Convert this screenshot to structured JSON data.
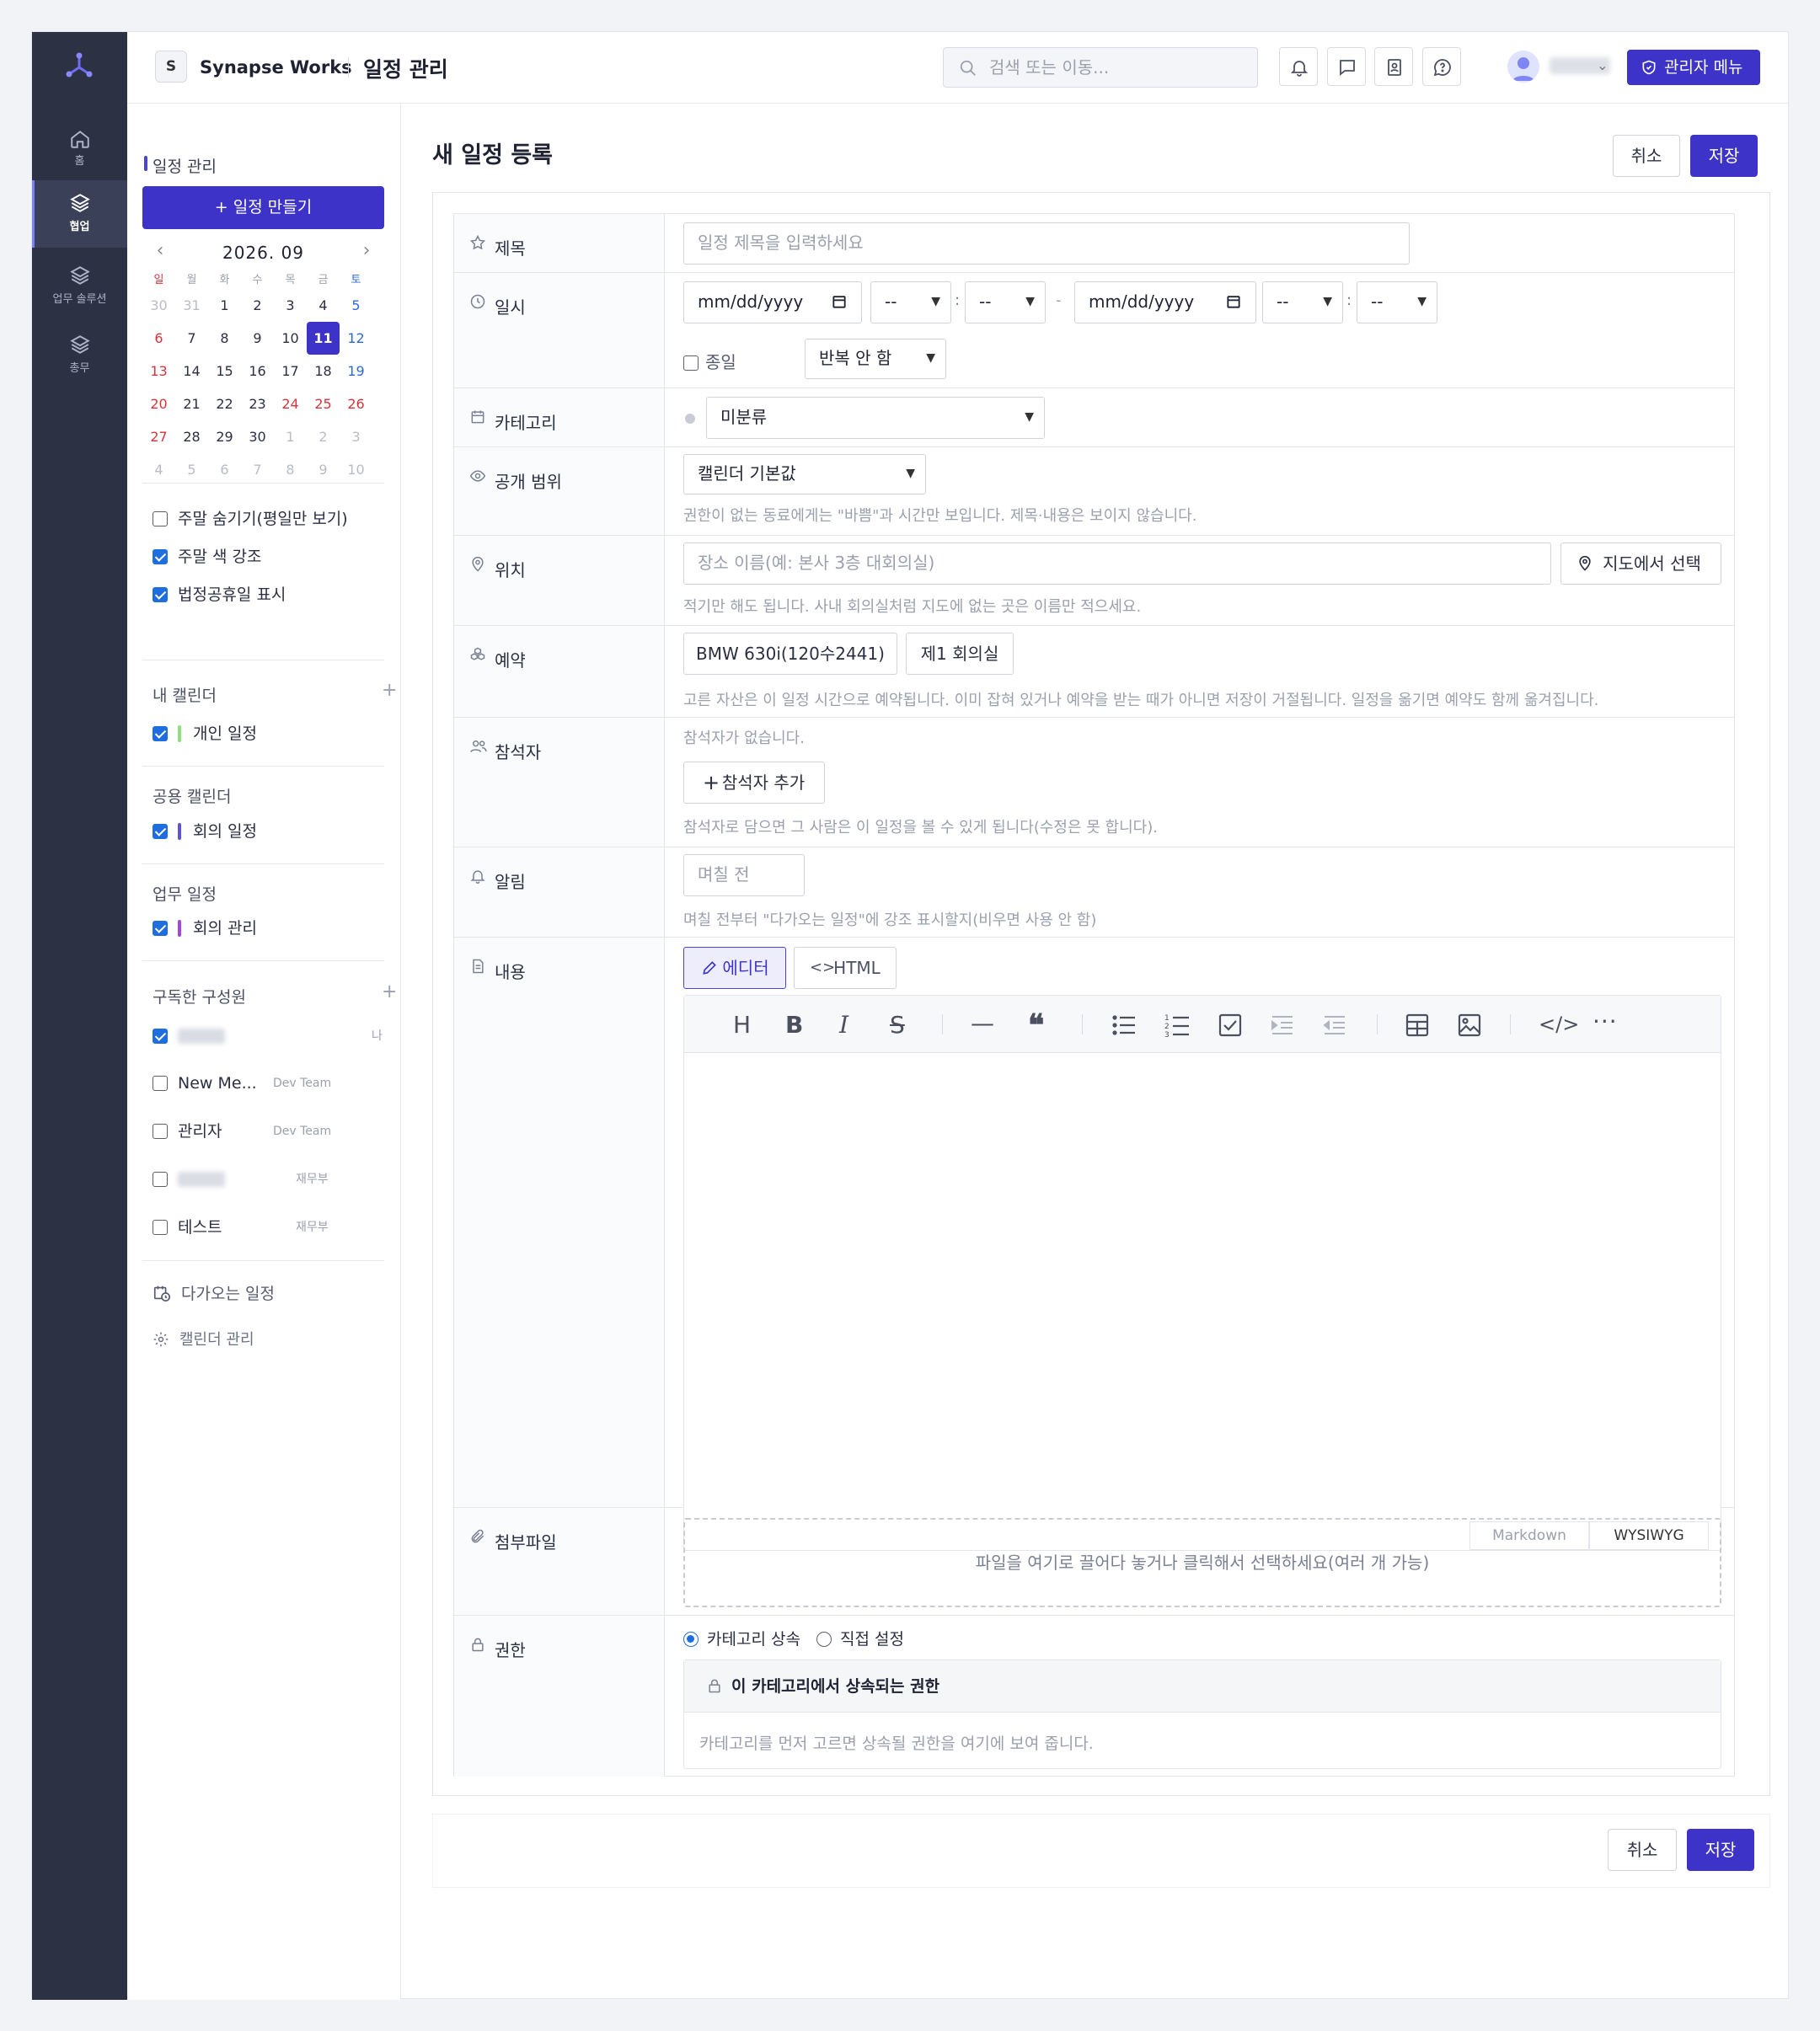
{
  "app": {
    "brand_initial": "S",
    "brand_name": "Synapse Works",
    "page_title": "일정 관리"
  },
  "colors": {
    "primary": "#3d33c9",
    "rail": "#2c3144",
    "sunday": "#d6343c",
    "saturday": "#2c6bd4"
  },
  "rail": [
    {
      "icon": "home-icon",
      "label": "홈",
      "active": false
    },
    {
      "icon": "layers-icon",
      "label": "협업",
      "active": true
    },
    {
      "icon": "layers-icon",
      "label": "업무 솔루션",
      "active": false
    },
    {
      "icon": "layers-icon",
      "label": "총무",
      "active": false
    }
  ],
  "header": {
    "search_placeholder": "검색 또는 이동...",
    "icons": [
      "bell-icon",
      "chat-icon",
      "contacts-icon",
      "help-chat-icon"
    ],
    "admin_label": "관리자 메뉴"
  },
  "sidebar": {
    "title": "일정 관리",
    "create_label": "+ 일정 만들기",
    "month_label": "2026. 09",
    "weekdays": [
      "일",
      "월",
      "화",
      "수",
      "목",
      "금",
      "토"
    ],
    "weeks": [
      [
        "30",
        "31",
        "1",
        "2",
        "3",
        "4",
        "5"
      ],
      [
        "6",
        "7",
        "8",
        "9",
        "10",
        "11",
        "12"
      ],
      [
        "13",
        "14",
        "15",
        "16",
        "17",
        "18",
        "19"
      ],
      [
        "20",
        "21",
        "22",
        "23",
        "24",
        "25",
        "26"
      ],
      [
        "27",
        "28",
        "29",
        "30",
        "1",
        "2",
        "3"
      ],
      [
        "4",
        "5",
        "6",
        "7",
        "8",
        "9",
        "10"
      ]
    ],
    "today": "11",
    "options": [
      {
        "label": "주말 숨기기(평일만 보기)",
        "checked": false
      },
      {
        "label": "주말 색 강조",
        "checked": true
      },
      {
        "label": "법정공휴일 표시",
        "checked": true
      }
    ],
    "my_calendars": {
      "title": "내 캘린더",
      "add": "+",
      "items": [
        {
          "label": "개인 일정",
          "color": "#8ee07e",
          "checked": true
        }
      ]
    },
    "shared_calendars": {
      "title": "공용 캘린더",
      "items": [
        {
          "label": "회의 일정",
          "color": "#5b52e0",
          "checked": true
        }
      ]
    },
    "work_calendars": {
      "title": "업무 일정",
      "items": [
        {
          "label": "회의 관리",
          "color": "#a347d8",
          "checked": true
        }
      ]
    },
    "subscribed": {
      "title": "구독한 구성원",
      "add": "+",
      "members": [
        {
          "name": "",
          "team": "나",
          "checked": true,
          "blurred": true
        },
        {
          "name": "New Me...",
          "team": "Dev Team",
          "checked": false,
          "blurred": false
        },
        {
          "name": "관리자",
          "team": "Dev Team",
          "checked": false,
          "blurred": false
        },
        {
          "name": "",
          "team": "재무부",
          "checked": false,
          "blurred": true
        },
        {
          "name": "테스트",
          "team": "재무부",
          "checked": false,
          "blurred": false
        }
      ]
    },
    "links": [
      {
        "icon": "calendar-clock-icon",
        "label": "다가오는 일정"
      },
      {
        "icon": "gear-icon",
        "label": "캘린더 관리"
      }
    ]
  },
  "form": {
    "title": "새 일정 등록",
    "cancel_label": "취소",
    "save_label": "저장",
    "fields": {
      "title": {
        "label": "제목",
        "placeholder": "일정 제목을 입력하세요"
      },
      "datetime": {
        "label": "일시",
        "date_placeholder": "mm/dd/yyyy",
        "time_placeholder": "--",
        "range_sep": "-",
        "colon": ":",
        "allday_label": "종일",
        "repeat_value": "반복 안 함"
      },
      "category": {
        "label": "카테고리",
        "value": "미분류"
      },
      "visibility": {
        "label": "공개 범위",
        "value": "캘린더 기본값",
        "help": "권한이 없는 동료에게는 \"바쁨\"과 시간만 보입니다. 제목·내용은 보이지 않습니다."
      },
      "location": {
        "label": "위치",
        "placeholder": "장소 이름(예: 본사 3층 대회의실)",
        "map_button": "지도에서 선택",
        "help": "적기만 해도 됩니다. 사내 회의실처럼 지도에 없는 곳은 이름만 적으세요."
      },
      "reservation": {
        "label": "예약",
        "assets": [
          "BMW 630i(120수2441)",
          "제1 회의실"
        ],
        "help": "고른 자산은 이 일정 시간으로 예약됩니다. 이미 잡혀 있거나 예약을 받는 때가 아니면 저장이 거절됩니다. 일정을 옮기면 예약도 함께 옮겨집니다."
      },
      "attendees": {
        "label": "참석자",
        "empty": "참석자가 없습니다.",
        "add_button": "참석자 추가",
        "help": "참석자로 담으면 그 사람은 이 일정을 볼 수 있게 됩니다(수정은 못 합니다)."
      },
      "alarm": {
        "label": "알림",
        "placeholder": "며칠 전",
        "help": "며칠 전부터 \"다가오는 일정\"에 강조 표시할지(비우면 사용 안 함)"
      },
      "content": {
        "label": "내용",
        "tab_editor": "에디터",
        "tab_html": "HTML",
        "mode_markdown": "Markdown",
        "mode_wysiwyg": "WYSIWYG"
      },
      "attachments": {
        "label": "첨부파일",
        "dropzone": "파일을 여기로 끌어다 놓거나 클릭해서 선택하세요(여러 개 가능)"
      },
      "permission": {
        "label": "권한",
        "option_inherit": "카테고리 상속",
        "option_custom": "직접 설정",
        "box_title": "이 카테고리에서 상속되는 권한",
        "box_body": "카테고리를 먼저 고르면 상속될 권한을 여기에 보여 줍니다."
      }
    }
  }
}
